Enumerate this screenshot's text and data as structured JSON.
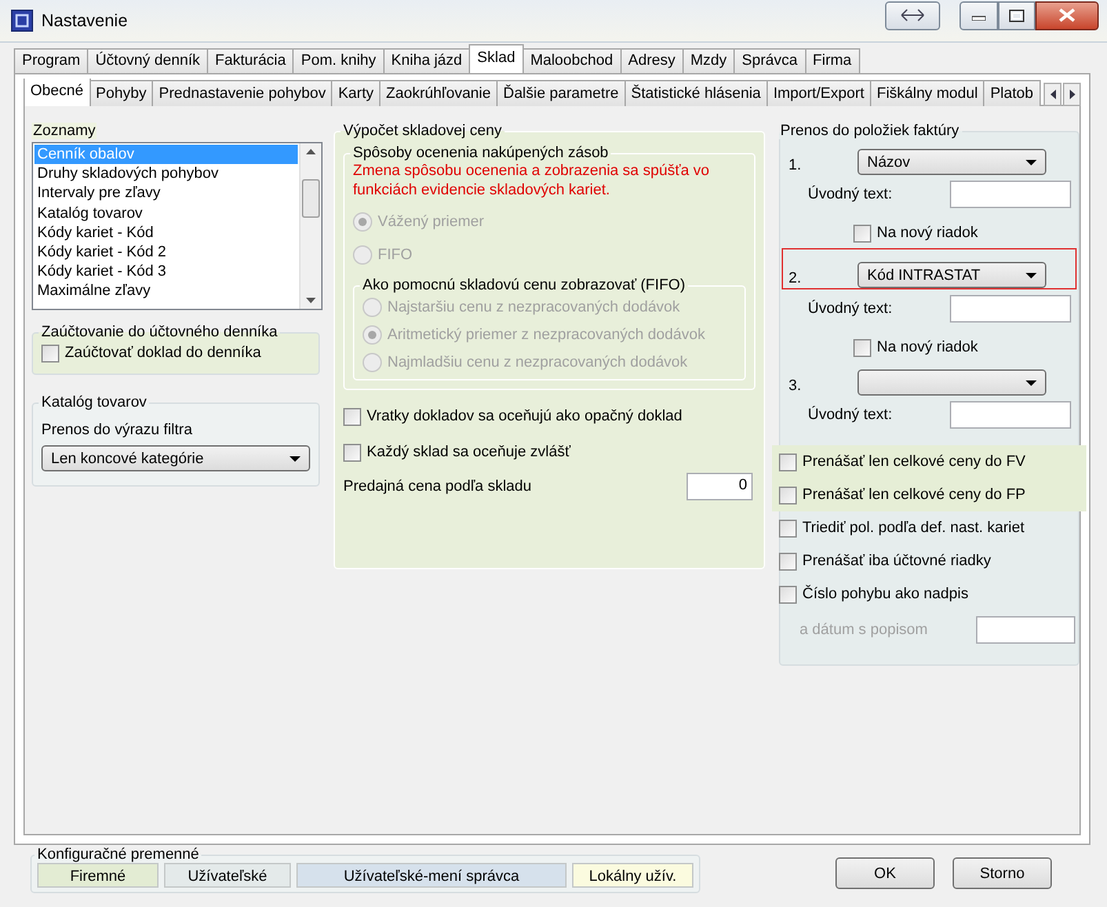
{
  "window": {
    "title": "Nastavenie"
  },
  "tabs": [
    {
      "label": "Program",
      "selected": false
    },
    {
      "label": "Účtovný denník",
      "selected": false
    },
    {
      "label": "Fakturácia",
      "selected": false
    },
    {
      "label": "Pom. knihy",
      "selected": false
    },
    {
      "label": "Kniha jázd",
      "selected": false
    },
    {
      "label": "Sklad",
      "selected": true
    },
    {
      "label": "Maloobchod",
      "selected": false
    },
    {
      "label": "Adresy",
      "selected": false
    },
    {
      "label": "Mzdy",
      "selected": false
    },
    {
      "label": "Správca",
      "selected": false
    },
    {
      "label": "Firma",
      "selected": false
    }
  ],
  "subtabs": [
    {
      "label": "Obecné",
      "selected": true
    },
    {
      "label": "Pohyby",
      "selected": false
    },
    {
      "label": "Prednastavenie pohybov",
      "selected": false
    },
    {
      "label": "Karty",
      "selected": false
    },
    {
      "label": "Zaokrúhľovanie",
      "selected": false
    },
    {
      "label": "Ďalšie parametre",
      "selected": false
    },
    {
      "label": "Štatistické hlásenia",
      "selected": false
    },
    {
      "label": "Import/Export",
      "selected": false
    },
    {
      "label": "Fiškálny modul",
      "selected": false
    },
    {
      "label": "Platob",
      "selected": false
    }
  ],
  "zoznamy": {
    "label": "Zoznamy",
    "items": [
      {
        "label": "Cenník obalov",
        "selected": true
      },
      {
        "label": "Druhy skladových pohybov",
        "selected": false
      },
      {
        "label": "Intervaly pre zľavy",
        "selected": false
      },
      {
        "label": "Katalóg tovarov",
        "selected": false
      },
      {
        "label": "Kódy kariet - Kód",
        "selected": false
      },
      {
        "label": "Kódy kariet - Kód 2",
        "selected": false
      },
      {
        "label": "Kódy kariet - Kód 3",
        "selected": false
      },
      {
        "label": "Maximálne zľavy",
        "selected": false
      }
    ]
  },
  "zauctovanie": {
    "title": "Zaúčtovanie do účtovného denníka",
    "option": {
      "label": "Zaúčtovať doklad do denníka",
      "checked": false
    }
  },
  "katalog": {
    "title": "Katalóg tovarov",
    "label": "Prenos do výrazu filtra",
    "value": "Len koncové kategórie"
  },
  "vypocet": {
    "title": "Výpočet skladovej ceny",
    "methods": {
      "title": "Spôsoby ocenenia nakúpených zásob",
      "note": "Zmena spôsobu ocenenia a zobrazenia sa spúšťa vo funkciách evidencie skladových kariet.",
      "disabled": true,
      "options": [
        {
          "label": "Vážený priemer",
          "selected": true
        },
        {
          "label": "FIFO",
          "selected": false
        }
      ],
      "fifo": {
        "title": "Ako pomocnú skladovú cenu zobrazovať (FIFO)",
        "options": [
          {
            "label": "Najstaršiu cenu z nezpracovaných dodávok",
            "selected": false
          },
          {
            "label": "Aritmetický priemer z nezpracovaných dodávok",
            "selected": true
          },
          {
            "label": "Najmladšiu cenu z nezpracovaných dodávok",
            "selected": false
          }
        ]
      }
    },
    "checks": [
      {
        "label": "Vratky dokladov sa oceňujú ako opačný doklad",
        "checked": false
      },
      {
        "label": "Každý sklad sa oceňuje zvlášť",
        "checked": false
      }
    ],
    "price": {
      "label": "Predajná cena podľa skladu",
      "value": "0"
    }
  },
  "prenos": {
    "title": "Prenos do položiek faktúry",
    "rows": [
      {
        "number": "1.",
        "value": "Názov",
        "highlighted": false,
        "intro_label": "Úvodný text:",
        "newline": {
          "label": "Na nový riadok",
          "checked": false
        }
      },
      {
        "number": "2.",
        "value": "Kód INTRASTAT",
        "highlighted": true,
        "intro_label": "Úvodný text:",
        "newline": {
          "label": "Na nový riadok",
          "checked": false
        }
      },
      {
        "number": "3.",
        "highlighted": false,
        "intro_label": "Úvodný text:"
      }
    ],
    "checks": [
      {
        "label": "Prenášať len celkové ceny do FV",
        "checked": false,
        "color": "#e6eed6"
      },
      {
        "label": "Prenášať len celkové ceny do FP",
        "checked": false,
        "color": "#e6eed6"
      },
      {
        "label": "Triediť pol. podľa def. nast. kariet",
        "checked": false
      },
      {
        "label": "Prenášať iba účtovné riadky",
        "checked": false
      },
      {
        "label": "Číslo pohybu ako nadpis",
        "checked": false
      }
    ],
    "date": {
      "label": "a dátum s popisom",
      "disabled": true
    }
  },
  "config": {
    "title": "Konfiguračné premenné",
    "items": [
      {
        "label": "Firemné",
        "color": "#e3ecd3"
      },
      {
        "label": "Užívateľské",
        "color": "#e4eaea"
      },
      {
        "label": "Užívateľské-mení správca",
        "color": "#d6e1ec"
      },
      {
        "label": "Lokálny užív.",
        "color": "#fbfbdf"
      }
    ]
  },
  "buttons": [
    "OK",
    "Storno"
  ]
}
